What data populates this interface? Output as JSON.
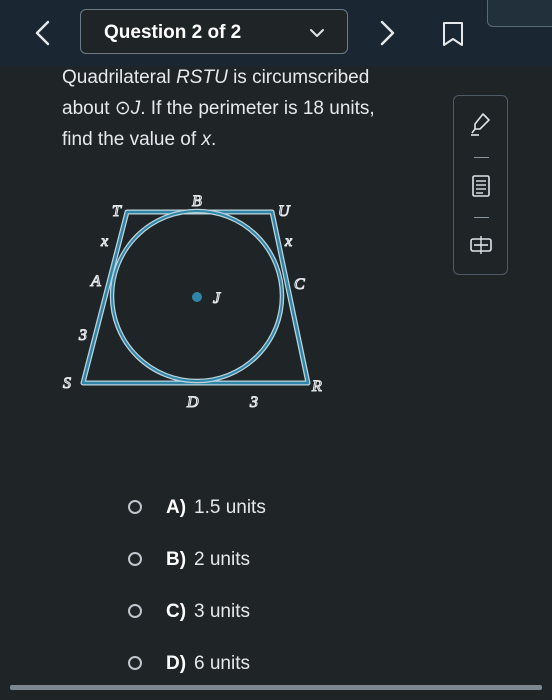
{
  "header": {
    "question_label": "Question 2 of 2",
    "back_icon": "chevron-left-icon",
    "next_icon": "chevron-right-icon",
    "bookmark_icon": "bookmark-icon",
    "dropdown_icon": "chevron-down-icon"
  },
  "question": {
    "line1_before": "Quadrilateral ",
    "shape_name": "RSTU",
    "line1_after": " is circumscribed",
    "line2_before": "about ",
    "circle_symbol": "⊙",
    "circle_name": "J",
    "line2_after": ". If the perimeter is 18 units,",
    "line3_before": "find the value of ",
    "variable": "x",
    "line3_after": "."
  },
  "figure": {
    "label_T": "T",
    "label_B": "B",
    "label_U": "U",
    "label_x_left": "x",
    "label_x_right": "x",
    "label_A": "A",
    "label_C": "C",
    "label_J": "J",
    "label_3_left": "3",
    "label_S": "S",
    "label_D": "D",
    "label_3_bottom": "3",
    "label_R": "R"
  },
  "tools": [
    {
      "name": "highlighter-icon"
    },
    {
      "name": "notepad-icon"
    },
    {
      "name": "calculator-icon"
    }
  ],
  "choices": [
    {
      "letter": "A)",
      "text": "1.5 units"
    },
    {
      "letter": "B)",
      "text": "2 units"
    },
    {
      "letter": "C)",
      "text": "3 units"
    },
    {
      "letter": "D)",
      "text": "6 units"
    }
  ],
  "colors": {
    "background": "#1f2427",
    "header": "#1a2733",
    "figure_blue": "#2f86a8",
    "figure_outline": "#bcd3dc"
  }
}
